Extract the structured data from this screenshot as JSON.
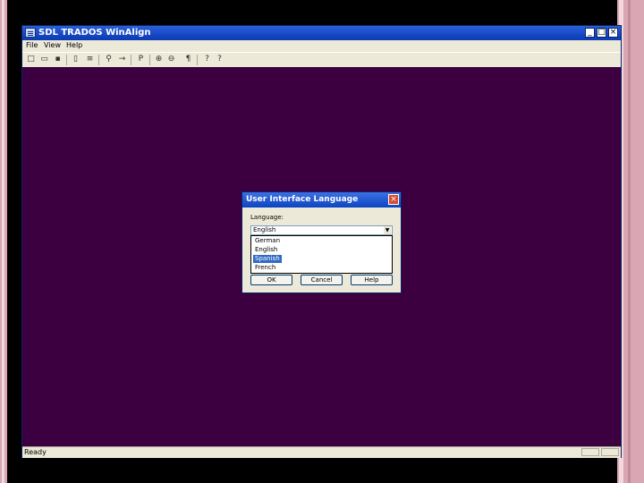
{
  "window": {
    "title": "SDL TRADOS WinAlign",
    "minimize": "_",
    "maximize": "□",
    "close": "×"
  },
  "menu": [
    "File",
    "View",
    "Help"
  ],
  "toolbar": [
    "□",
    "▭",
    "▪",
    "▯",
    "≡",
    "⚲",
    "→",
    "P",
    "⊕",
    "⊖",
    "¶",
    "?",
    "?"
  ],
  "status": {
    "text": "Ready"
  },
  "dialog": {
    "title": "User Interface Language",
    "close": "×",
    "label": "Language:",
    "selected_value": "English",
    "arrow": "▼",
    "options": [
      "German",
      "English",
      "Spanish",
      "French"
    ],
    "highlighted_index": 2,
    "buttons": {
      "ok": "OK",
      "cancel": "Cancel",
      "help": "Help"
    }
  }
}
